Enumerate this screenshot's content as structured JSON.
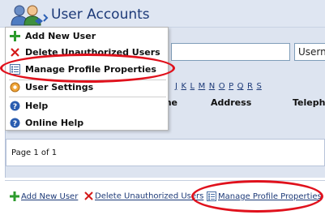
{
  "header": {
    "title": "User Accounts",
    "icon": "users-icon"
  },
  "search": {
    "value": "",
    "select_value": "Userna"
  },
  "letters": [
    "J",
    "K",
    "L",
    "M",
    "N",
    "O",
    "P",
    "Q",
    "R",
    "S"
  ],
  "columns": {
    "name": "Name",
    "address": "Address",
    "telephone": "Telephone"
  },
  "pager": {
    "text": "Page 1 of 1"
  },
  "menu": {
    "items": [
      {
        "label": "Add New User",
        "icon": "add-icon"
      },
      {
        "label": "Delete Unauthorized Users",
        "icon": "delete-icon"
      },
      {
        "label": "Manage Profile Properties",
        "icon": "profile-properties-icon"
      },
      {
        "label": "User Settings",
        "icon": "settings-icon"
      },
      {
        "label": "Help",
        "icon": "help-icon"
      },
      {
        "label": "Online Help",
        "icon": "help-icon"
      }
    ]
  },
  "actions": {
    "add_user": "Add New User",
    "delete_unauthorized": "Delete Unauthorized Users",
    "manage_profile": "Manage Profile Properties"
  },
  "colors": {
    "title": "#1d3a78",
    "panel": "#dde4f0",
    "annotation": "#e0111c"
  }
}
